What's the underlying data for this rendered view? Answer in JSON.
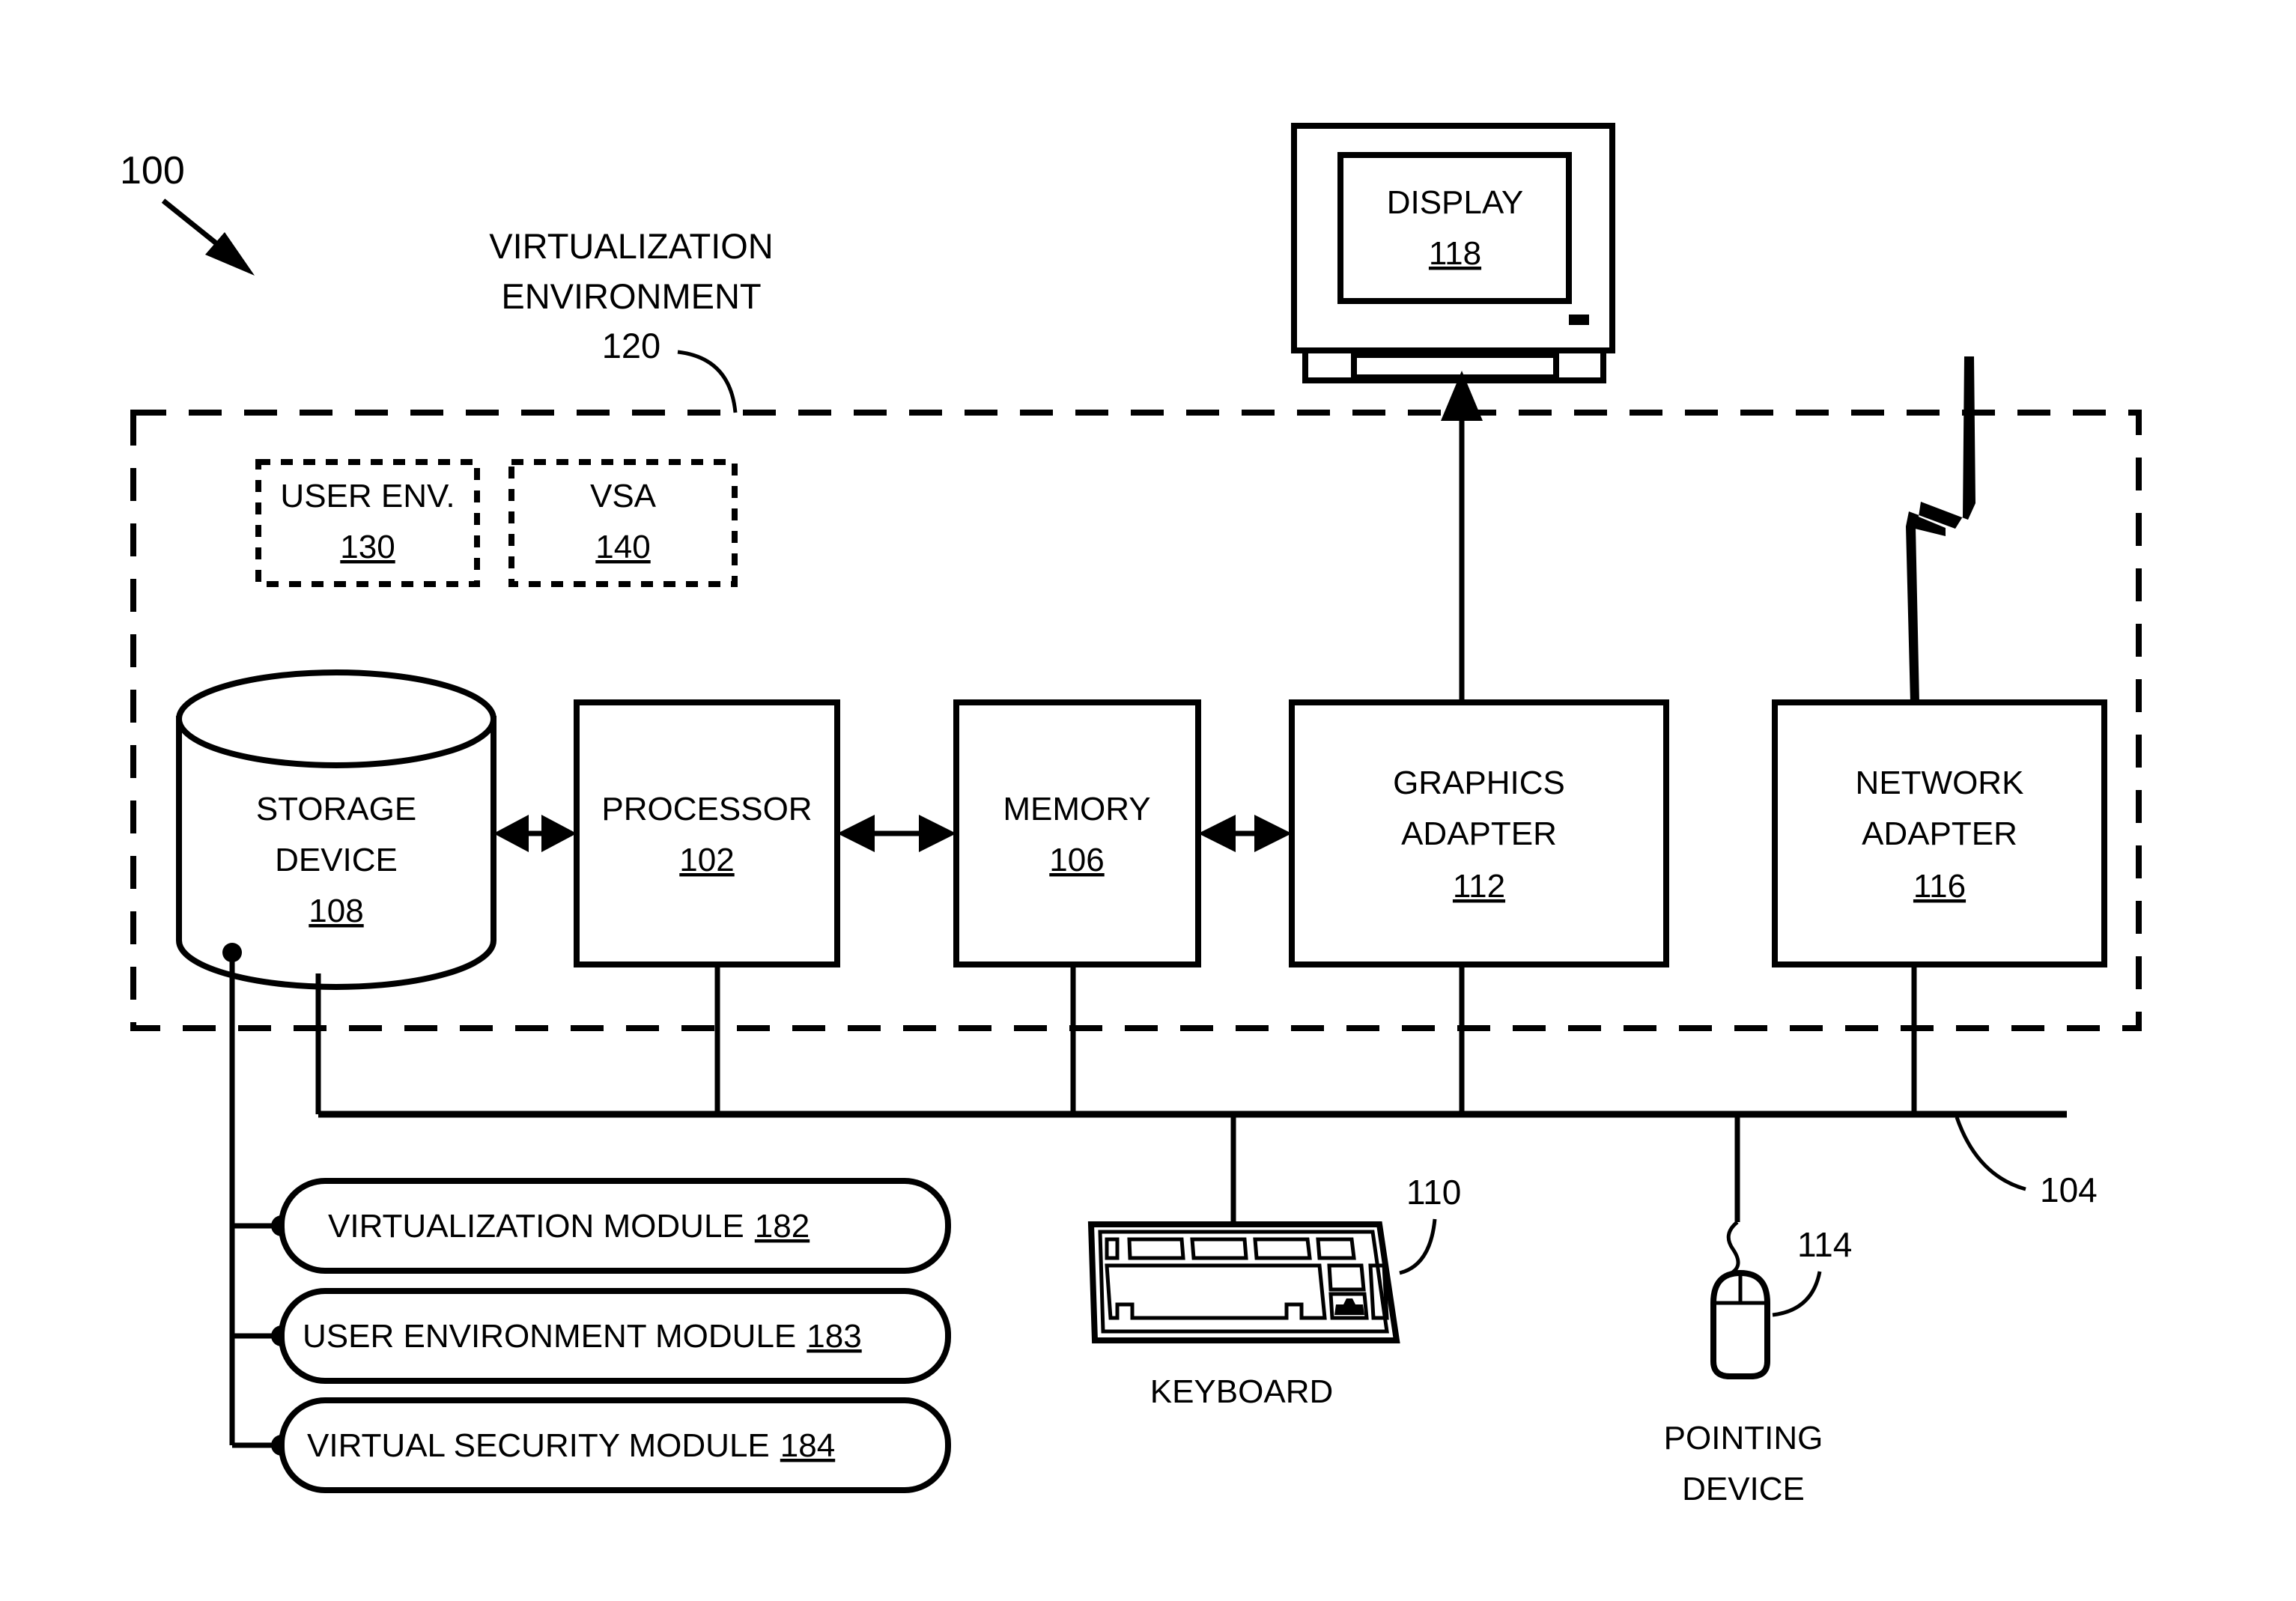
{
  "figure": {
    "figure_ref": "100",
    "environment": {
      "label_line1": "VIRTUALIZATION",
      "label_line2": "ENVIRONMENT",
      "ref": "120"
    },
    "bus_ref": "104",
    "inner_blocks": [
      {
        "name": "user-env",
        "label": "USER ENV.",
        "ref": "130"
      },
      {
        "name": "vsa",
        "label": "VSA",
        "ref": "140"
      }
    ],
    "components": {
      "storage": {
        "label_line1": "STORAGE",
        "label_line2": "DEVICE",
        "ref": "108"
      },
      "processor": {
        "label": "PROCESSOR",
        "ref": "102"
      },
      "memory": {
        "label": "MEMORY",
        "ref": "106"
      },
      "graphics_adapter": {
        "label_line1": "GRAPHICS",
        "label_line2": "ADAPTER",
        "ref": "112"
      },
      "network_adapter": {
        "label_line1": "NETWORK",
        "label_line2": "ADAPTER",
        "ref": "116"
      },
      "display": {
        "label": "DISPLAY",
        "ref": "118"
      },
      "keyboard": {
        "label": "KEYBOARD",
        "ref": "110"
      },
      "pointing_device": {
        "label_line1": "POINTING",
        "label_line2": "DEVICE",
        "ref": "114"
      }
    },
    "modules": [
      {
        "name": "virtualization-module",
        "label": "VIRTUALIZATION MODULE",
        "ref": "182"
      },
      {
        "name": "user-environment-module",
        "label": "USER ENVIRONMENT MODULE",
        "ref": "183"
      },
      {
        "name": "virtual-security-module",
        "label": "VIRTUAL SECURITY MODULE",
        "ref": "184"
      }
    ],
    "colors": {
      "ink": "#000000",
      "paper": "#ffffff"
    }
  }
}
